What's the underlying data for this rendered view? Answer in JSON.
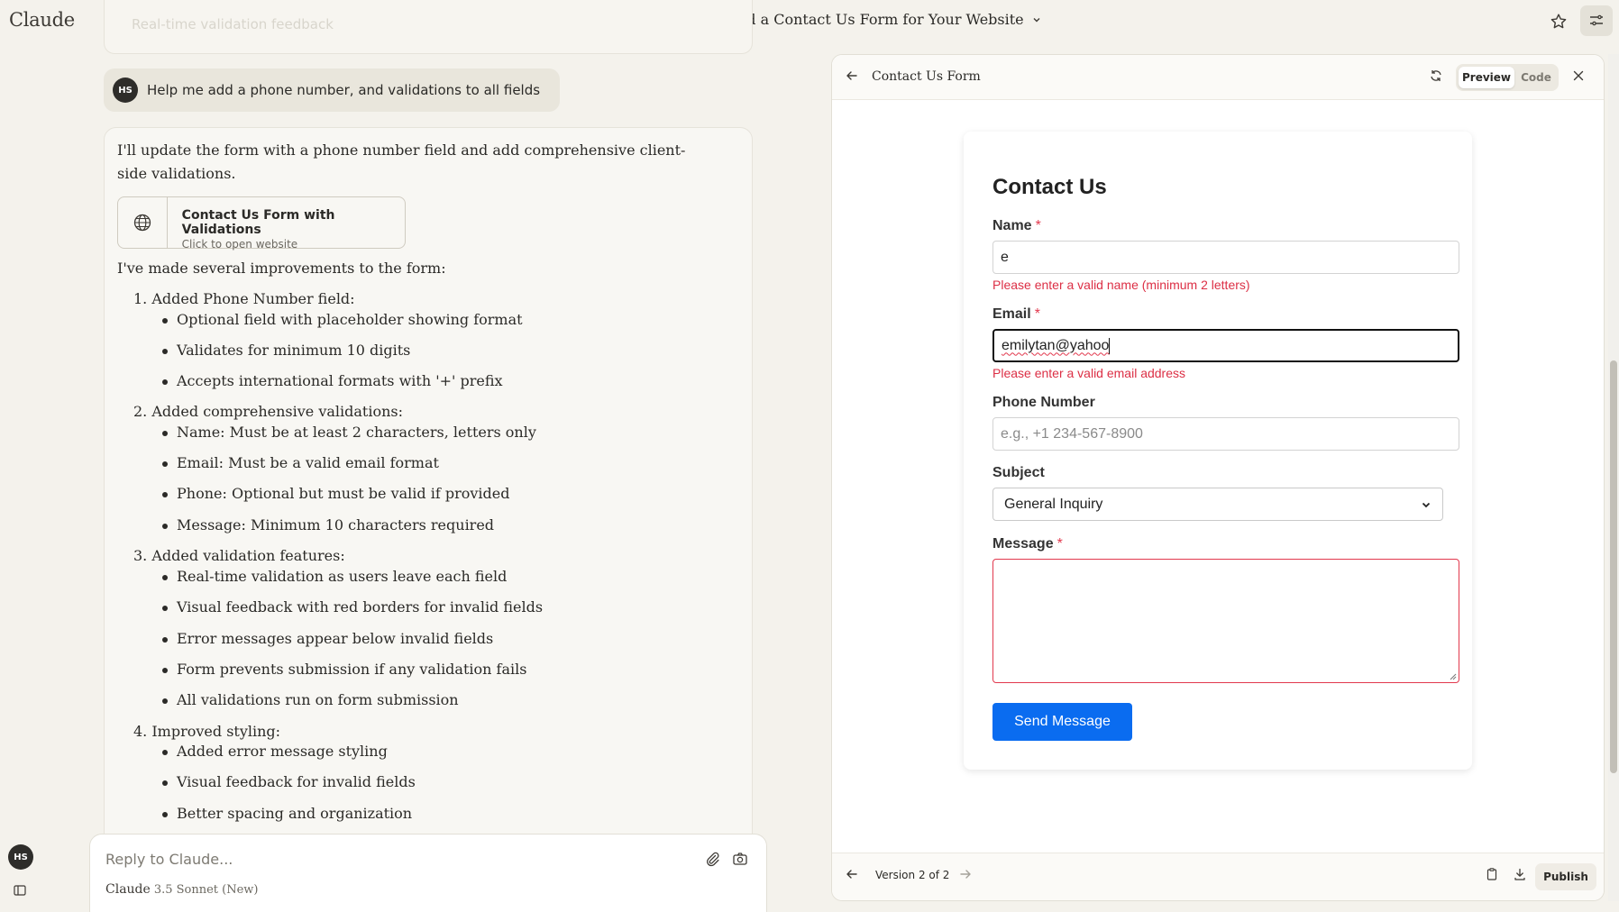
{
  "app": {
    "brand": "Claude"
  },
  "conversation": {
    "title": "Build a Contact Us Form for Your Website"
  },
  "previous_card": {
    "faded_text": "Real-time validation feedback"
  },
  "user_message": {
    "initials": "HS",
    "text": "Help me add a phone number, and validations to all fields"
  },
  "reply": {
    "intro": "I'll update the form with a phone number field and add comprehensive client-side validations.",
    "artifact_button": {
      "title": "Contact Us Form with Validations",
      "subtitle": "Click to open website",
      "icon": "globe-icon"
    },
    "improvements_intro": "I've made several improvements to the form:",
    "sections": [
      {
        "heading": "1. Added Phone Number field:",
        "bullets": [
          "Optional field with placeholder showing format",
          "Validates for minimum 10 digits",
          "Accepts international formats with '+' prefix"
        ]
      },
      {
        "heading": "2. Added comprehensive validations:",
        "bullets": [
          "Name: Must be at least 2 characters, letters only",
          "Email: Must be a valid email format",
          "Phone: Optional but must be valid if provided",
          "Message: Minimum 10 characters required"
        ]
      },
      {
        "heading": "3. Added validation features:",
        "bullets": [
          "Real-time validation as users leave each field",
          "Visual feedback with red borders for invalid fields",
          "Error messages appear below invalid fields",
          "Form prevents submission if any validation fails",
          "All validations run on form submission"
        ]
      },
      {
        "heading": "4. Improved styling:",
        "bullets": [
          "Added error message styling",
          "Visual feedback for invalid fields",
          "Better spacing and organization"
        ]
      }
    ]
  },
  "composer": {
    "placeholder": "Reply to Claude...",
    "model_name": "Claude",
    "model_version": "3.5 Sonnet (New)"
  },
  "sidebar": {
    "user_initials": "HS"
  },
  "panel": {
    "title": "Contact Us Form",
    "tabs": {
      "preview": "Preview",
      "code": "Code"
    },
    "footer": {
      "version": "Version 2 of 2",
      "publish": "Publish"
    }
  },
  "form": {
    "title": "Contact Us",
    "required_marker": "*",
    "name": {
      "label": "Name",
      "value": "e",
      "error": "Please enter a valid name (minimum 2 letters)"
    },
    "email": {
      "label": "Email",
      "value": "emilytan@yahoo",
      "error": "Please enter a valid email address"
    },
    "phone": {
      "label": "Phone Number",
      "placeholder": "e.g., +1 234-567-8900"
    },
    "subject": {
      "label": "Subject",
      "selected": "General Inquiry"
    },
    "message": {
      "label": "Message",
      "value": ""
    },
    "submit": "Send Message"
  },
  "colors": {
    "accent_button": "#0a6cf0",
    "error": "#dc2f45",
    "page_bg": "#f4f2ec"
  }
}
